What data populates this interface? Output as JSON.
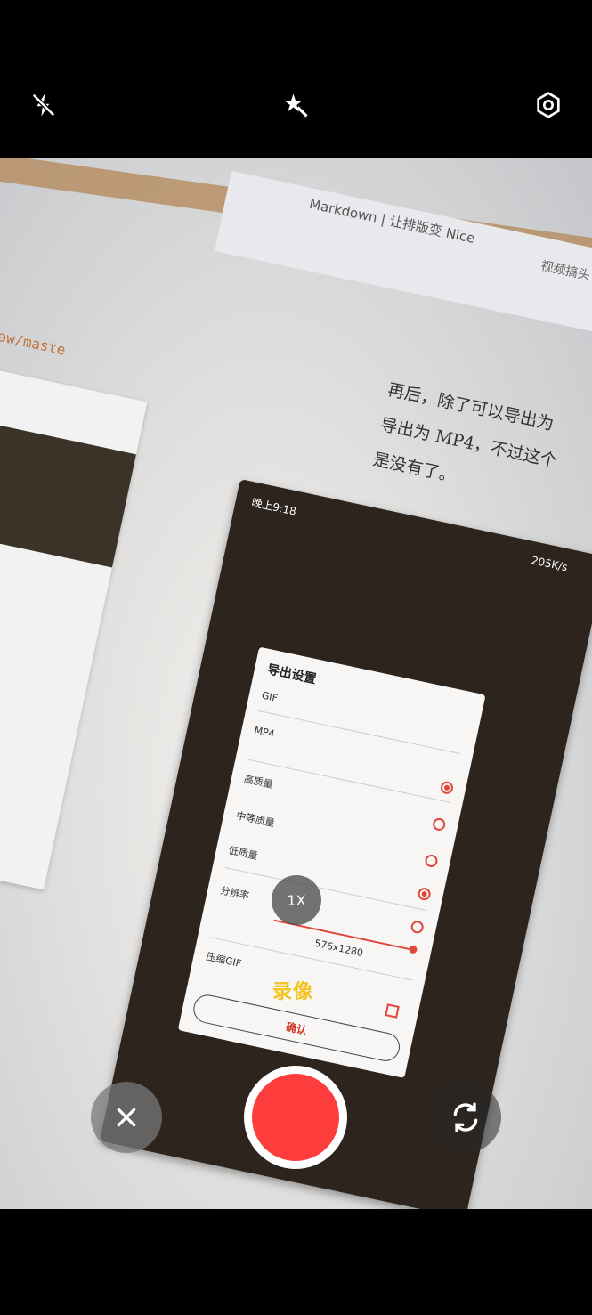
{
  "topbar": {
    "flash_icon": "flash-off-icon",
    "effects_icon": "magic-wand-icon",
    "settings_icon": "settings-gear-icon"
  },
  "scene": {
    "tab_title": "Markdown | 让排版变 Nice",
    "tab_title2": "视频搞头",
    "code_fragment": "aw/maste",
    "article_lines": [
      "再后，除了可以导出为",
      "导出为 MP4，不过这个",
      "是没有了。"
    ],
    "phone_status_time": "晚上9:18",
    "phone_status_speed": "205K/s",
    "dialog": {
      "title": "导出设置",
      "rows": [
        "GIF",
        "MP4",
        "高质量",
        "中等质量",
        "低质量",
        "分辨率",
        "压缩GIF"
      ],
      "resolution_value": "576x1280",
      "confirm_label": "确认"
    }
  },
  "camera": {
    "zoom_label": "1X",
    "mode_label": "录像",
    "cancel_icon": "close-icon",
    "switch_camera_icon": "switch-camera-icon",
    "record_color": "#fd3c3c",
    "mode_color": "#f2c31b"
  }
}
